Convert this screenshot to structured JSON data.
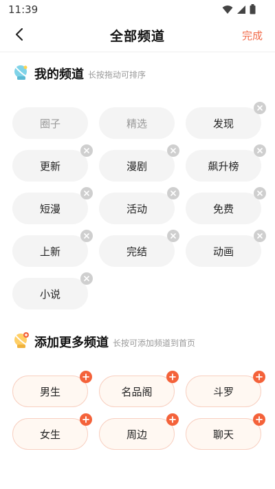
{
  "status_bar": {
    "time": "11:39"
  },
  "header": {
    "title": "全部频道",
    "done_label": "完成"
  },
  "my_channels": {
    "title": "我的频道",
    "hint": "长按拖动可排序",
    "items": [
      {
        "label": "圈子",
        "removable": false
      },
      {
        "label": "精选",
        "removable": false
      },
      {
        "label": "发现",
        "removable": true
      },
      {
        "label": "更新",
        "removable": true
      },
      {
        "label": "漫剧",
        "removable": true
      },
      {
        "label": "飙升榜",
        "removable": true
      },
      {
        "label": "短漫",
        "removable": true
      },
      {
        "label": "活动",
        "removable": true
      },
      {
        "label": "免费",
        "removable": true
      },
      {
        "label": "上新",
        "removable": true
      },
      {
        "label": "完结",
        "removable": true
      },
      {
        "label": "动画",
        "removable": true
      },
      {
        "label": "小说",
        "removable": true
      }
    ]
  },
  "more_channels": {
    "title": "添加更多频道",
    "hint": "长按可添加频道到首页",
    "items": [
      {
        "label": "男生"
      },
      {
        "label": "名品阁"
      },
      {
        "label": "斗罗"
      },
      {
        "label": "女生"
      },
      {
        "label": "周边"
      },
      {
        "label": "聊天"
      }
    ]
  },
  "colors": {
    "accent": "#f26b4a",
    "add_badge": "#f4623a",
    "chip_bg": "#f4f4f4",
    "remove_badge": "#cfcfcf"
  },
  "icons": {
    "my_section": "satellite-dish-icon",
    "more_section": "satellite-dish-plus-icon"
  }
}
